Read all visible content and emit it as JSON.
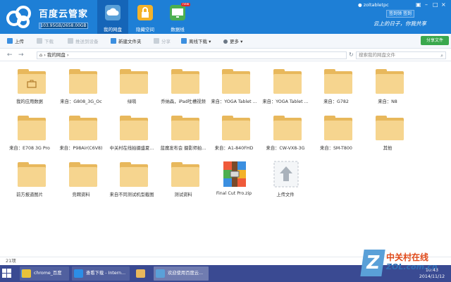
{
  "app": {
    "title": "百度云管家",
    "quota": "103.95GB/2658.00GB",
    "quota_fraction": 0.039,
    "username": "zoltabletpc",
    "signin": "签到",
    "signin_hint": "签到领",
    "slogan": "云上的日子，你我共享"
  },
  "nav_tabs": [
    {
      "label": "我的网盘",
      "icon": "cloud-icon",
      "color": "#5aa0d8"
    },
    {
      "label": "隐藏空间",
      "icon": "lock-icon",
      "color": "#f3b229"
    },
    {
      "label": "数据线",
      "icon": "monitor-icon",
      "color": "#4caf50",
      "badge": "new"
    }
  ],
  "toolbar": {
    "upload": "上传",
    "download": "下载",
    "push": "推送到设备",
    "new_folder": "新建文件夹",
    "share": "分享",
    "offline": "离线下载",
    "more": "更多",
    "share_files": "分享文件"
  },
  "address": {
    "breadcrumb": "我的网盘",
    "search_placeholder": "搜索我的网盘文件"
  },
  "files": [
    {
      "name": "我的应用数据",
      "kind": "app-folder"
    },
    {
      "name": "来自：G808_3G_Oc",
      "kind": "folder"
    },
    {
      "name": "绿萌",
      "kind": "folder"
    },
    {
      "name": "乔纳森，iPad吐槽视频",
      "kind": "folder"
    },
    {
      "name": "来自：YOGA Tablet ...",
      "kind": "folder"
    },
    {
      "name": "来自：YOGA Tablet ...",
      "kind": "folder"
    },
    {
      "name": "来自：G782",
      "kind": "folder"
    },
    {
      "name": "来自：N8",
      "kind": "folder"
    },
    {
      "name": "来自：E708 3G Pro",
      "kind": "folder"
    },
    {
      "name": "来自：P98Air(C6V8)",
      "kind": "folder"
    },
    {
      "name": "中关村在线拍摄盛夏...",
      "kind": "folder"
    },
    {
      "name": "蓝魔发布会 摄影师拍...",
      "kind": "folder"
    },
    {
      "name": "来自：A1-840FHD",
      "kind": "folder"
    },
    {
      "name": "来自：CW-VX8-3G",
      "kind": "folder"
    },
    {
      "name": "来自：SM-T800",
      "kind": "folder"
    },
    {
      "name": "其他",
      "kind": "folder"
    },
    {
      "name": "前方报道图片",
      "kind": "folder"
    },
    {
      "name": "竞聘资料",
      "kind": "folder"
    },
    {
      "name": "来自不同测试机型截图",
      "kind": "folder"
    },
    {
      "name": "测试资料",
      "kind": "folder"
    },
    {
      "name": "Final Cut Pro.zip",
      "kind": "zip"
    },
    {
      "name": "上传文件",
      "kind": "upload"
    }
  ],
  "status": {
    "count": "21项"
  },
  "taskbar": {
    "tasks": [
      {
        "label": "chrome_百度搜...",
        "icon": "chrome-icon"
      },
      {
        "label": "查看下载 - Intern...",
        "icon": "ie-icon"
      },
      {
        "label": "欢迎使用百度云...",
        "icon": "baiduyun-icon"
      }
    ],
    "time": "10:43",
    "date": "2014/11/12"
  },
  "watermark": {
    "cn": "中关村在线",
    "en": "ZOL.com.cn"
  }
}
